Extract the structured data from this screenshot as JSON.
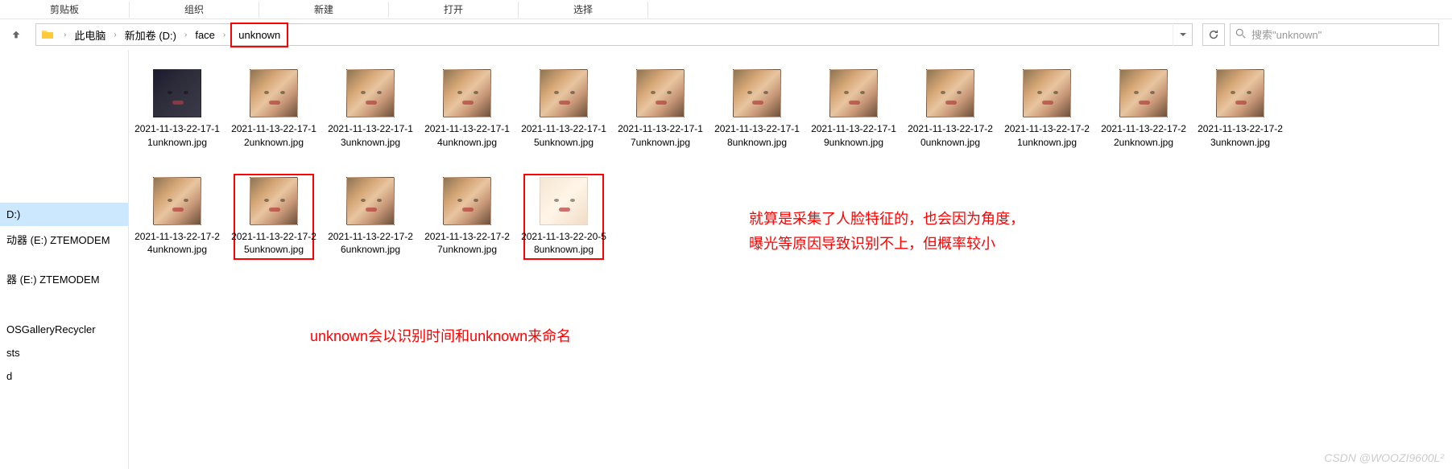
{
  "ribbon": {
    "tabs": [
      "剪贴板",
      "组织",
      "新建",
      "打开",
      "选择"
    ]
  },
  "breadcrumb": {
    "items": [
      "此电脑",
      "新加卷 (D:)",
      "face",
      "unknown"
    ]
  },
  "search": {
    "placeholder": "搜索\"unknown\""
  },
  "sidebar": {
    "items": [
      {
        "label": "D:)",
        "selected": true
      },
      {
        "label": "动器 (E:) ZTEMODEM",
        "selected": false
      },
      {
        "label": "",
        "spacer": true
      },
      {
        "label": "器 (E:) ZTEMODEM",
        "selected": false
      },
      {
        "label": "",
        "spacer": true
      },
      {
        "label": "",
        "spacer": true
      },
      {
        "label": "OSGalleryRecycler",
        "selected": false
      },
      {
        "label": "sts",
        "selected": false
      },
      {
        "label": "d",
        "selected": false
      }
    ]
  },
  "files": {
    "row1": [
      {
        "name": "2021-11-13-22-17-11unknown.jpg",
        "thumb": "dark"
      },
      {
        "name": "2021-11-13-22-17-12unknown.jpg",
        "thumb": "normal"
      },
      {
        "name": "2021-11-13-22-17-13unknown.jpg",
        "thumb": "normal"
      },
      {
        "name": "2021-11-13-22-17-14unknown.jpg",
        "thumb": "normal"
      },
      {
        "name": "2021-11-13-22-17-15unknown.jpg",
        "thumb": "normal"
      },
      {
        "name": "2021-11-13-22-17-17unknown.jpg",
        "thumb": "normal"
      },
      {
        "name": "2021-11-13-22-17-18unknown.jpg",
        "thumb": "normal"
      },
      {
        "name": "2021-11-13-22-17-19unknown.jpg",
        "thumb": "normal"
      },
      {
        "name": "2021-11-13-22-17-20unknown.jpg",
        "thumb": "normal"
      },
      {
        "name": "2021-11-13-22-17-21unknown.jpg",
        "thumb": "normal"
      },
      {
        "name": "2021-11-13-22-17-22unknown.jpg",
        "thumb": "normal"
      },
      {
        "name": "2021-11-13-22-17-23unknown.jpg",
        "thumb": "normal"
      }
    ],
    "row2": [
      {
        "name": "2021-11-13-22-17-24unknown.jpg",
        "thumb": "normal",
        "hl": false
      },
      {
        "name": "2021-11-13-22-17-25unknown.jpg",
        "thumb": "normal",
        "hl": true
      },
      {
        "name": "2021-11-13-22-17-26unknown.jpg",
        "thumb": "normal",
        "hl": false
      },
      {
        "name": "2021-11-13-22-17-27unknown.jpg",
        "thumb": "normal",
        "hl": false
      },
      {
        "name": "2021-11-13-22-20-58unknown.jpg",
        "thumb": "light",
        "hl": true
      }
    ]
  },
  "annotations": {
    "a1": "unknown会以识别时间和unknown来命名",
    "a2_line1": "就算是采集了人脸特征的，也会因为角度，",
    "a2_line2": "曝光等原因导致识别不上，但概率较小"
  },
  "watermark": "CSDN @WOOZI9600L²"
}
